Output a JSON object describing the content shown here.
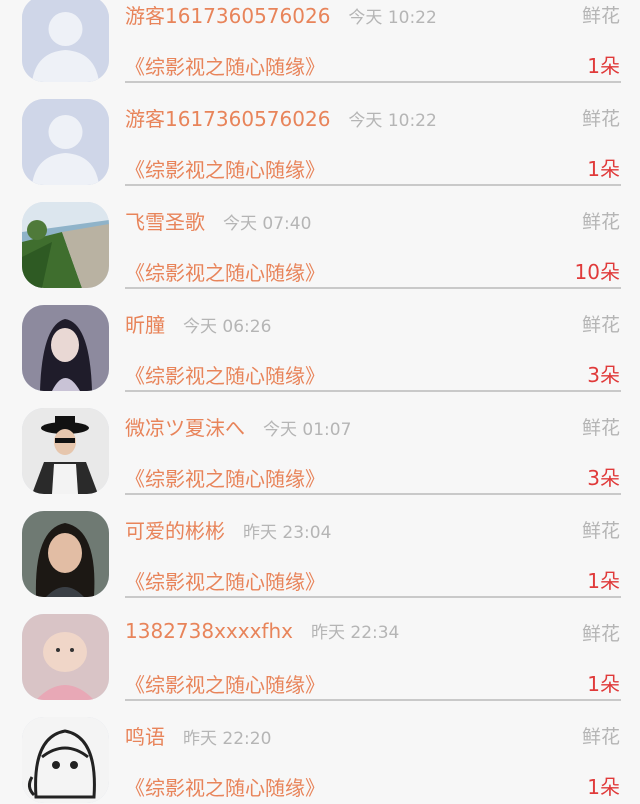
{
  "gifts": [
    {
      "name": "游客1617360576026",
      "time": "今天 10:22",
      "gift": "鲜花",
      "book": "《综影视之随心随缘》",
      "count": "1朵",
      "avatar": "default-avatar"
    },
    {
      "name": "游客1617360576026",
      "time": "今天 10:22",
      "gift": "鲜花",
      "book": "《综影视之随心随缘》",
      "count": "1朵",
      "avatar": "default-avatar"
    },
    {
      "name": "飞雪圣歌",
      "time": "今天 07:40",
      "gift": "鲜花",
      "book": "《综影视之随心随缘》",
      "count": "10朵",
      "avatar": "road-photo"
    },
    {
      "name": "昕朣",
      "time": "今天 06:26",
      "gift": "鲜花",
      "book": "《综影视之随心随缘》",
      "count": "3朵",
      "avatar": "anime-girl"
    },
    {
      "name": "微凉ツ夏沫へ",
      "time": "今天 01:07",
      "gift": "鲜花",
      "book": "《综影视之随心随缘》",
      "count": "3朵",
      "avatar": "man-hat"
    },
    {
      "name": "可爱的彬彬",
      "time": "昨天 23:04",
      "gift": "鲜花",
      "book": "《综影视之随心随缘》",
      "count": "1朵",
      "avatar": "woman-photo"
    },
    {
      "name": "1382738xxxxfhx",
      "time": "昨天 22:34",
      "gift": "鲜花",
      "book": "《综影视之随心随缘》",
      "count": "1朵",
      "avatar": "baby-photo"
    },
    {
      "name": "鸣语",
      "time": "昨天 22:20",
      "gift": "鲜花",
      "book": "《综影视之随心随缘》",
      "count": "1朵",
      "avatar": "manga-girl"
    }
  ]
}
